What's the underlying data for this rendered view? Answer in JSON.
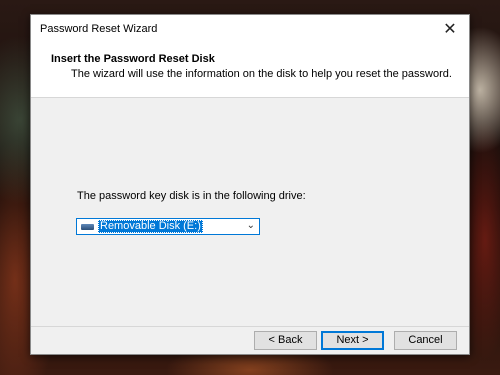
{
  "window": {
    "title": "Password Reset Wizard",
    "close_glyph": "✕"
  },
  "header": {
    "title": "Insert the Password Reset Disk",
    "subtitle": "The wizard will use the information on the disk to help you reset the password."
  },
  "main": {
    "drive_label": "The password key disk is in the following drive:",
    "drive_select": {
      "selected": "Removable Disk (E:)",
      "icon": "removable-disk-icon",
      "dropdown_glyph": "⌄"
    }
  },
  "buttons": {
    "back": "< Back",
    "next": "Next >",
    "cancel": "Cancel"
  },
  "colors": {
    "accent": "#0078d7",
    "window_bg": "#f0f0f0",
    "header_bg": "#ffffff"
  }
}
